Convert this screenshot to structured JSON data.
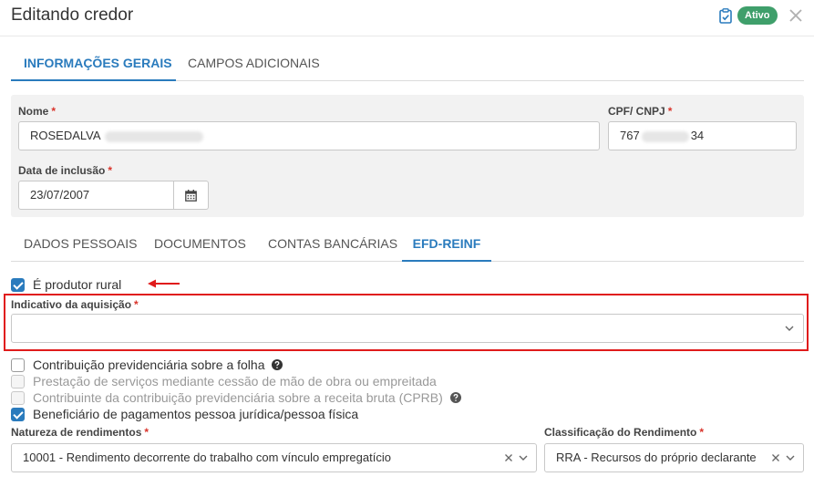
{
  "header": {
    "title": "Editando credor",
    "status_badge": "Ativo",
    "clipboard_icon": "clipboard-check-icon",
    "close_icon": "close-icon",
    "badge_color": "#3f9f6b"
  },
  "main_tabs": [
    {
      "label": "INFORMAÇÕES GERAIS",
      "active": true
    },
    {
      "label": "CAMPOS ADICIONAIS",
      "active": false
    }
  ],
  "form": {
    "nome_label": "Nome",
    "nome_value": "ROSEDALVA",
    "cpf_label": "CPF/ CNPJ",
    "cpf_prefix": "767",
    "cpf_suffix": "34",
    "data_label": "Data de inclusão",
    "data_value": "23/07/2007",
    "required_mark": "*"
  },
  "sub_tabs": [
    {
      "label": "DADOS PESSOAIS",
      "active": false
    },
    {
      "label": "DOCUMENTOS",
      "active": false
    },
    {
      "label": "CONTAS BANCÁRIAS",
      "active": false
    },
    {
      "label": "EFD-REINF",
      "active": true
    }
  ],
  "efd": {
    "produtor_rural_label": "É produtor rural",
    "indicativo_label": "Indicativo da aquisição",
    "indicativo_value": "",
    "checkboxes": [
      {
        "label": "Contribuição previdenciária sobre a folha",
        "checked": false,
        "disabled": false,
        "help": true
      },
      {
        "label": "Prestação de serviços mediante cessão de mão de obra ou empreitada",
        "checked": false,
        "disabled": true,
        "help": false
      },
      {
        "label": "Contribuinte da contribuição previdenciária sobre a receita bruta (CPRB)",
        "checked": false,
        "disabled": true,
        "help": true
      },
      {
        "label": "Beneficiário de pagamentos pessoa jurídica/pessoa física",
        "checked": true,
        "disabled": false,
        "help": false
      }
    ],
    "natureza_label": "Natureza de rendimentos",
    "natureza_value": "10001 - Rendimento decorrente do trabalho com vínculo empregatício",
    "classificacao_label": "Classificação do Rendimento",
    "classificacao_value": "RRA - Recursos do próprio declarante"
  },
  "colors": {
    "accent": "#2a7bbd",
    "required": "#d9342b",
    "highlight": "#e01b1b"
  }
}
